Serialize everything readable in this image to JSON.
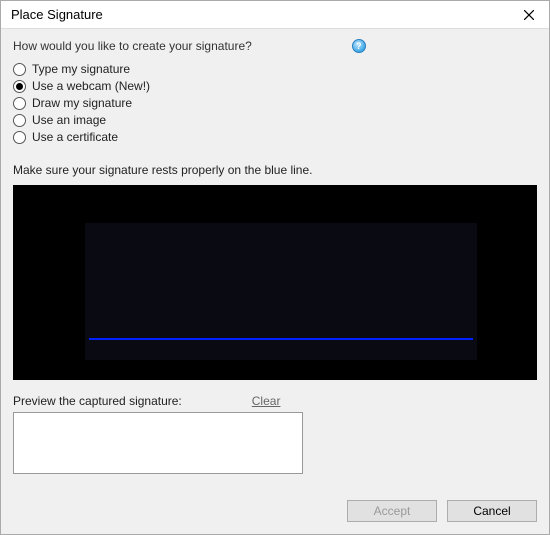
{
  "dialog": {
    "title": "Place Signature",
    "question": "How would you like to create your signature?",
    "instruction": "Make sure your signature rests properly on the blue line.",
    "preview_label": "Preview the captured signature:",
    "clear_link": "Clear"
  },
  "options": [
    {
      "label": "Type my signature",
      "selected": false
    },
    {
      "label": "Use a webcam (New!)",
      "selected": true
    },
    {
      "label": "Draw my signature",
      "selected": false
    },
    {
      "label": "Use an image",
      "selected": false
    },
    {
      "label": "Use a certificate",
      "selected": false
    }
  ],
  "buttons": {
    "accept": "Accept",
    "cancel": "Cancel"
  },
  "icons": {
    "help": "?"
  }
}
